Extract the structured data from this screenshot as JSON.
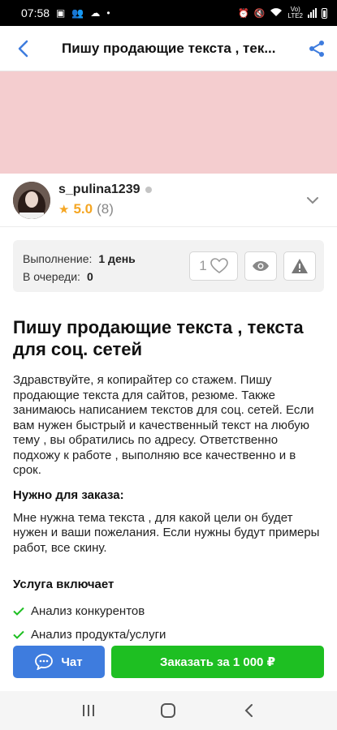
{
  "status": {
    "time": "07:58",
    "lte_top": "Vo)",
    "lte_bottom": "LTE2"
  },
  "header": {
    "title": "Пишу продающие текста , тек..."
  },
  "seller": {
    "name": "s_pulina1239",
    "rating": "5.0",
    "reviews": "(8)"
  },
  "info": {
    "execution_label": "Выполнение:",
    "execution_value": "1 день",
    "queue_label": "В очереди:",
    "queue_value": "0",
    "likes": "1"
  },
  "gig": {
    "title": "Пишу продающие текста , текста для соц. сетей",
    "description": "Здравствуйте, я копирайтер со стажем. Пишу продающие текста для сайтов, резюме. Также занимаюсь написанием текстов для соц. сетей. Если вам нужен быстрый и качественный текст на любую тему , вы обратились по адресу. Ответственно подхожу к работе , выполняю все качественно и в срок.",
    "requirements_heading": "Нужно для заказа:",
    "requirements": "Мне нужна тема текста , для какой цели он будет нужен и ваши пожелания. Если нужны будут примеры работ, все скину.",
    "includes_heading": "Услуга включает",
    "includes": [
      "Анализ конкурентов",
      "Анализ продукта/услуги"
    ]
  },
  "actions": {
    "chat_label": "Чат",
    "order_label": "Заказать за 1 000 ₽"
  },
  "colors": {
    "accent_blue": "#3e7cde",
    "order_green": "#1ebf22",
    "star": "#f5a623",
    "banner": "#f4cdcf"
  }
}
